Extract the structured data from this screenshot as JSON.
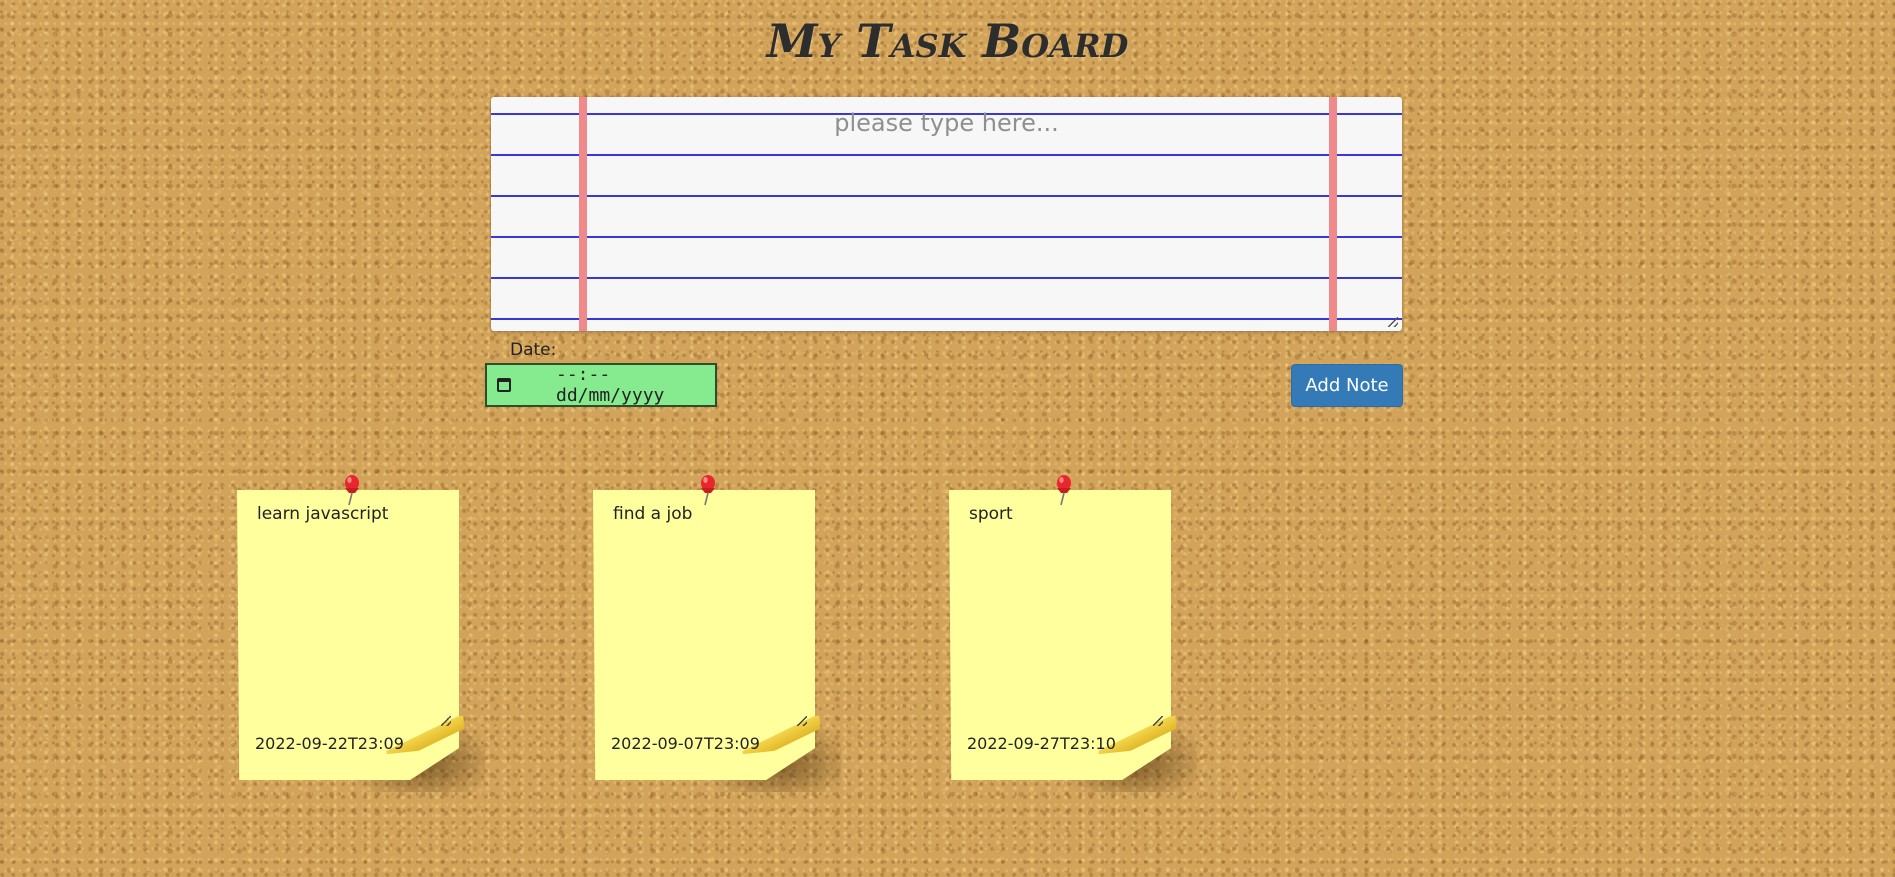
{
  "page": {
    "title": "My Task Board"
  },
  "form": {
    "textarea_placeholder": "please type here...",
    "date_label": "Date:",
    "date_placeholder": "--:-- dd/mm/yyyy",
    "add_button_label": "Add Note"
  },
  "notes": [
    {
      "text": "learn javascript",
      "datetime": "2022-09-22T23:09"
    },
    {
      "text": "find a job",
      "datetime": "2022-09-07T23:09"
    },
    {
      "text": "sport",
      "datetime": "2022-09-27T23:10"
    }
  ],
  "colors": {
    "cork": "#d2a35a",
    "note": "#ffff9e",
    "date_input": "#86ea8e",
    "button": "#337ab7",
    "paper_lines": "#3838d8",
    "paper_margin": "#f08a8a",
    "pin": "#e8262b"
  },
  "icons": {
    "calendar": "calendar-icon",
    "pin": "pushpin-icon"
  }
}
